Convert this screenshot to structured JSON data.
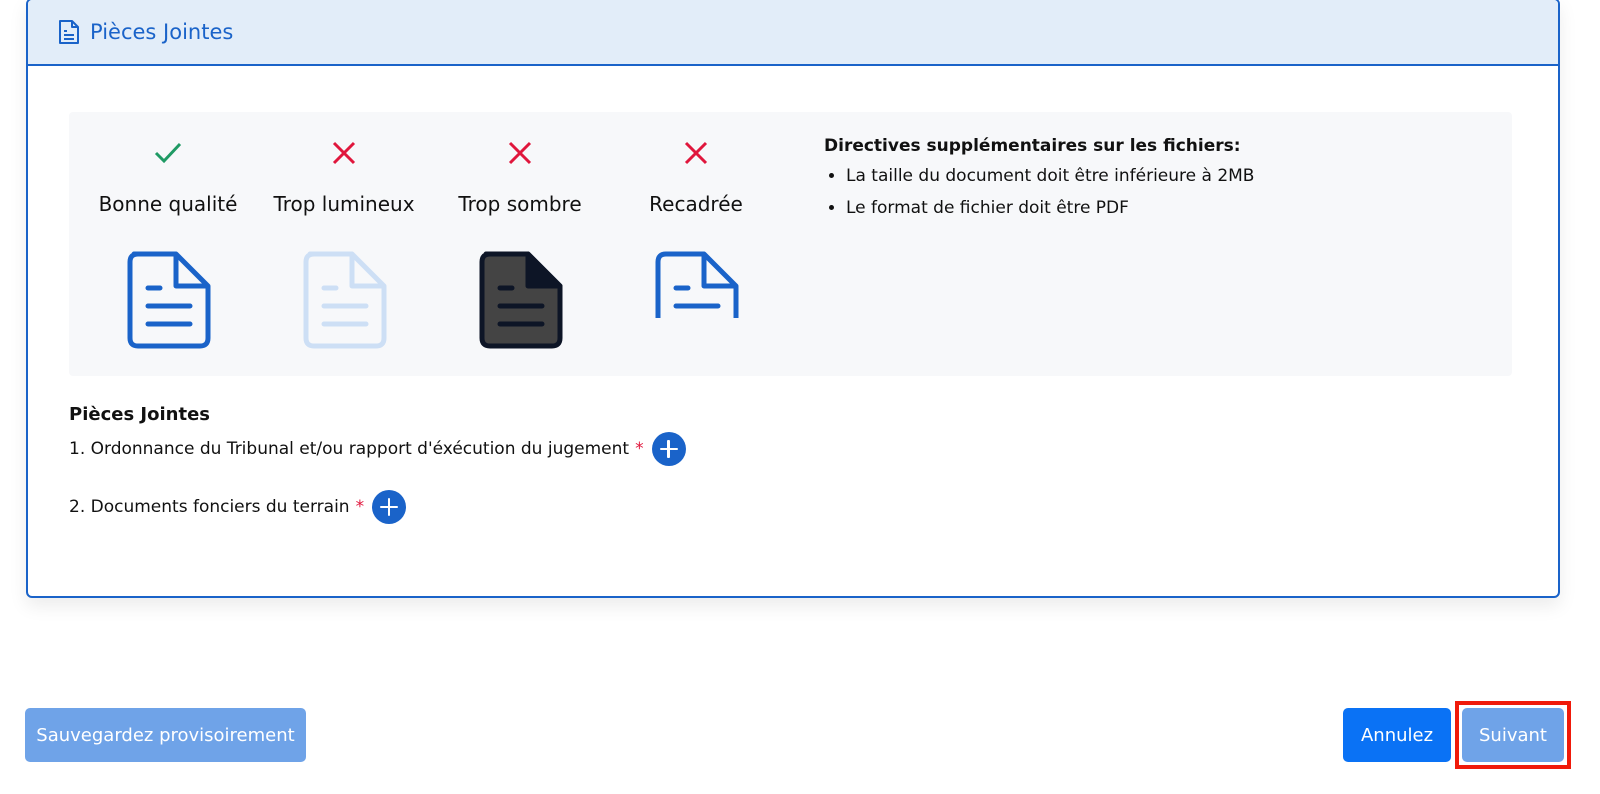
{
  "header": {
    "title": "Pièces Jointes"
  },
  "guide": {
    "samples": [
      {
        "label": "Bonne qualité",
        "status": "ok"
      },
      {
        "label": "Trop lumineux",
        "status": "bad"
      },
      {
        "label": "Trop sombre",
        "status": "bad"
      },
      {
        "label": "Recadrée",
        "status": "bad"
      }
    ],
    "guidelines_title": "Directives supplémentaires sur les fichiers:",
    "guidelines": [
      "La taille du document doit être inférieure à 2MB",
      "Le format de fichier doit être PDF"
    ]
  },
  "attachments": {
    "title": "Pièces Jointes",
    "items": [
      {
        "label": "1. Ordonnance du Tribunal et/ou rapport d'éxécution du jugement",
        "required_mark": "*"
      },
      {
        "label": "2. Documents fonciers du terrain",
        "required_mark": "*"
      }
    ]
  },
  "actions": {
    "save_draft": "Sauvegardez provisoirement",
    "cancel": "Annulez",
    "next": "Suivant"
  },
  "colors": {
    "primary": "#1a63c9",
    "ok": "#1f9a64",
    "error": "#e0163c",
    "highlight": "#f01a0a"
  }
}
